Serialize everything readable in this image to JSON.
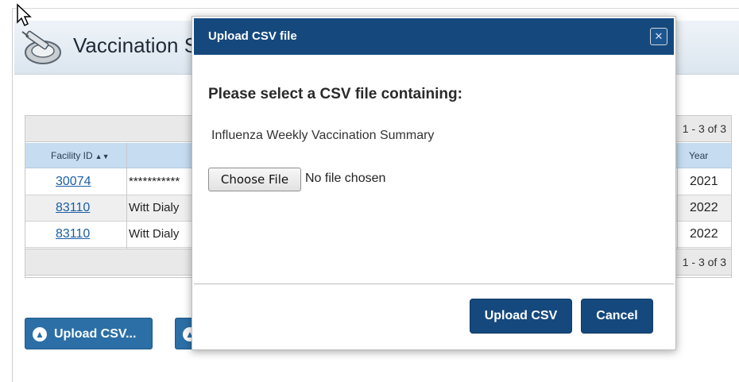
{
  "page": {
    "title": "Vaccination S",
    "pager": "1 - 3 of 3",
    "columns": {
      "facility_id": "Facility ID",
      "year": "Year"
    },
    "rows": [
      {
        "facility_id": "30074",
        "name": "***********",
        "year": "2021"
      },
      {
        "facility_id": "83110",
        "name": "Witt Dialy",
        "year": "2022"
      },
      {
        "facility_id": "83110",
        "name": "Witt Dialy",
        "year": "2022"
      }
    ],
    "upload_button": "Upload CSV...",
    "icon": "syringe-icon",
    "colors": {
      "header": "#c6dcf0",
      "button": "#2b6fa6",
      "link": "#1a5ea6"
    }
  },
  "modal": {
    "title": "Upload CSV file",
    "close_icon": "close-icon",
    "heading": "Please select a CSV file containing:",
    "description": "Influenza Weekly Vaccination Summary",
    "choose_file": "Choose File",
    "no_file": "No file chosen",
    "upload_label": "Upload CSV",
    "cancel_label": "Cancel",
    "colors": {
      "header": "#15497e"
    }
  }
}
